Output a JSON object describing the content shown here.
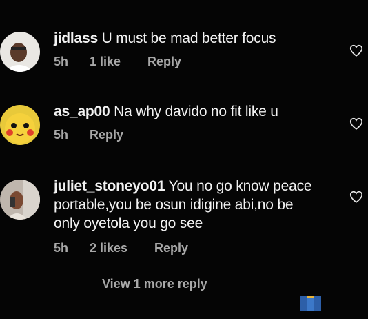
{
  "comments": [
    {
      "username": "jidlass",
      "text": "U must be mad better focus",
      "time": "5h",
      "likes": "1 like",
      "reply_label": "Reply"
    },
    {
      "username": "as_ap00",
      "text": "Na why davido no fit like u",
      "time": "5h",
      "likes": "",
      "reply_label": "Reply"
    },
    {
      "username": "juliet_stoneyo01",
      "text_line1": "You no go know peace",
      "text_line2": "portable,you be osun idigine abi,no be",
      "text_line3": "only oyetola you go see",
      "time": "5h",
      "likes": "2 likes",
      "reply_label": "Reply"
    }
  ],
  "view_more_label": "View 1 more reply",
  "icons": {
    "like": "heart-outline-icon",
    "watermark": "site-logo-icon"
  },
  "colors": {
    "background": "#050505",
    "text": "#f2f2f2",
    "muted": "#a8a8a8"
  }
}
